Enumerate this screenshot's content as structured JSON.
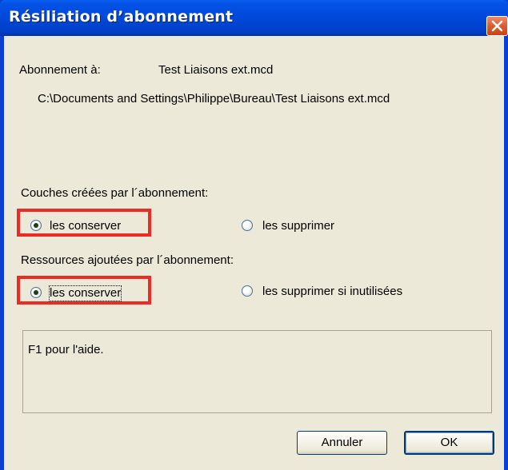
{
  "window": {
    "title": "Résiliation d’abonnement",
    "close_icon": "close-icon"
  },
  "subscription": {
    "label": "Abonnement à:",
    "name": "Test Liaisons ext.mcd",
    "path": "C:\\Documents and Settings\\Philippe\\Bureau\\Test Liaisons ext.mcd"
  },
  "layers": {
    "heading": "Couches créées par l´abonnement:",
    "keep_label": "les conserver",
    "delete_label": "les supprimer",
    "selected": "keep"
  },
  "resources": {
    "heading": "Ressources ajoutées par l´abonnement:",
    "keep_label": "les conserver",
    "delete_label": "les supprimer si inutilisées",
    "selected": "keep"
  },
  "help": {
    "text": "F1 pour l'aide."
  },
  "buttons": {
    "cancel_label": "Annuler",
    "ok_label": "OK"
  },
  "colors": {
    "titlebar": "#0048d8",
    "dialog_bg": "#ece9d8",
    "highlight": "#ee2a24",
    "close_button": "#e05a30"
  }
}
